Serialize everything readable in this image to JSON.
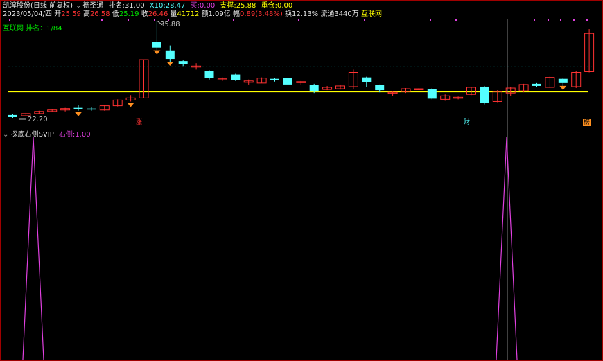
{
  "header": {
    "stock": "凯淳股份(日线 前复权)",
    "indicator": "德圣通",
    "rank_label": "排名:",
    "rank_value": "31.00",
    "x10_label": "X10:",
    "x10_value": "28.47",
    "buy_label": "买:",
    "buy_value": "0.00",
    "support_label": "支撑:",
    "support_value": "25.88",
    "heavy_label": "重仓:",
    "heavy_value": "0.00"
  },
  "quote": {
    "date": "2023/05/04/四",
    "open_label": "开",
    "open": "25.59",
    "high_label": "高",
    "high": "26.58",
    "low_label": "低",
    "low": "25.19",
    "close_label": "收",
    "close": "26.46",
    "vol_label": "量",
    "vol": "41712",
    "amount_label": "额",
    "amount": "1.09亿",
    "change_label": "幅",
    "change": "0.89(3.48%)",
    "turnover_label": "换",
    "turnover": "12.13%",
    "float_label": "流通",
    "float": "3440万",
    "concept": "互联网"
  },
  "ranking": "互联网 排名：1/84",
  "price_high_label": "35.88",
  "price_low_label": "22.20",
  "markers": {
    "zhang": "涨",
    "cai": "财",
    "bang": "榜"
  },
  "lower_panel": {
    "title": "探底右侧SVIP",
    "series_label": "右侧:",
    "series_value": "1.00"
  },
  "colors": {
    "up": "#ff3232",
    "down": "#54ffff",
    "support": "#ffff00",
    "dotted": "#00a0a0",
    "purple": "#e040e0",
    "frame": "#a00000",
    "cursor": "#808080",
    "diamond": "#ff9020"
  },
  "chart_data": {
    "type": "candlestick",
    "ohlc": [
      [
        22.6,
        22.3,
        22.7,
        22.2
      ],
      [
        22.5,
        22.8,
        22.9,
        22.4
      ],
      [
        22.8,
        23.1,
        23.2,
        22.7
      ],
      [
        23.1,
        23.3,
        23.4,
        23.0
      ],
      [
        23.3,
        23.5,
        23.6,
        23.1
      ],
      [
        23.6,
        23.4,
        24.0,
        23.2
      ],
      [
        23.5,
        23.4,
        23.7,
        23.2
      ],
      [
        23.3,
        23.9,
        24.0,
        23.2
      ],
      [
        23.9,
        24.7,
        24.8,
        23.8
      ],
      [
        24.7,
        25.0,
        25.4,
        24.5
      ],
      [
        25.0,
        30.4,
        30.4,
        25.0
      ],
      [
        32.9,
        32.1,
        35.88,
        31.6
      ],
      [
        31.7,
        30.5,
        32.4,
        29.9
      ],
      [
        30.2,
        29.8,
        30.3,
        29.5
      ],
      [
        29.4,
        29.5,
        29.9,
        29.0
      ],
      [
        28.8,
        27.8,
        28.9,
        27.6
      ],
      [
        27.6,
        27.7,
        27.9,
        27.4
      ],
      [
        28.3,
        27.5,
        28.4,
        27.4
      ],
      [
        27.2,
        27.4,
        27.6,
        26.9
      ],
      [
        27.1,
        27.8,
        27.9,
        27.1
      ],
      [
        27.7,
        27.6,
        27.8,
        27.3
      ],
      [
        27.8,
        26.9,
        27.8,
        26.8
      ],
      [
        27.3,
        27.3,
        27.4,
        26.8
      ],
      [
        26.8,
        25.9,
        27.0,
        25.7
      ],
      [
        26.2,
        26.5,
        26.7,
        26.1
      ],
      [
        26.3,
        26.7,
        26.8,
        26.2
      ],
      [
        26.6,
        28.6,
        29.0,
        26.2
      ],
      [
        27.9,
        27.2,
        28.0,
        26.6
      ],
      [
        26.8,
        26.1,
        26.9,
        25.8
      ],
      [
        25.8,
        25.8,
        26.0,
        25.3
      ],
      [
        25.9,
        26.3,
        26.4,
        25.7
      ],
      [
        26.2,
        26.3,
        26.4,
        26.1
      ],
      [
        26.3,
        24.9,
        26.4,
        24.8
      ],
      [
        24.8,
        25.3,
        25.5,
        24.6
      ],
      [
        25.1,
        25.1,
        25.2,
        24.8
      ],
      [
        25.5,
        26.5,
        26.6,
        25.4
      ],
      [
        26.6,
        24.3,
        26.7,
        24.1
      ],
      [
        24.5,
        25.9,
        26.1,
        24.4
      ],
      [
        25.7,
        26.4,
        26.6,
        25.3
      ],
      [
        26.0,
        26.9,
        27.0,
        25.8
      ],
      [
        27.0,
        26.7,
        27.1,
        26.5
      ],
      [
        26.5,
        27.9,
        28.1,
        26.4
      ],
      [
        27.7,
        27.1,
        27.8,
        26.6
      ],
      [
        26.6,
        28.6,
        28.8,
        26.4
      ],
      [
        28.7,
        34.1,
        34.7,
        28.6
      ]
    ],
    "support": 25.88,
    "dotted_level": 29.4,
    "indicator_peaks": [
      2,
      39
    ],
    "indicator_peak_value": 1.0
  }
}
